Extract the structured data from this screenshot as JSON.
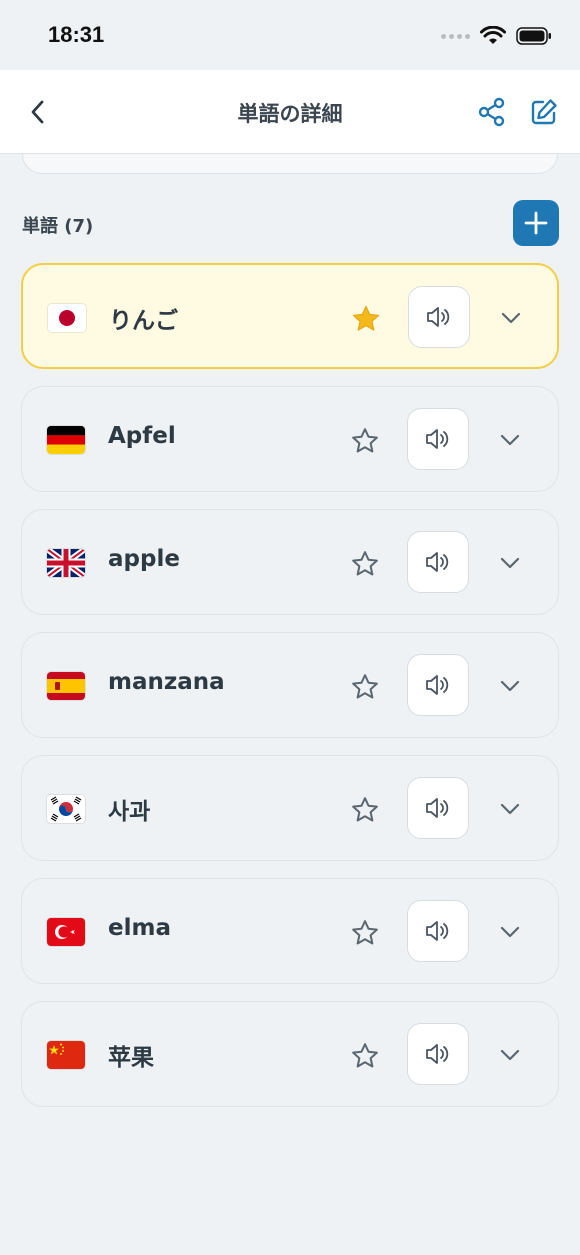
{
  "status_bar": {
    "time": "18:31"
  },
  "nav": {
    "title": "単語の詳細"
  },
  "section": {
    "label": "単語 (7)"
  },
  "colors": {
    "accent": "#1f78b4",
    "active_card_bg": "#fefbe2",
    "active_card_border": "#f2cf45",
    "star_gold": "#f5b81b"
  },
  "words": [
    {
      "flag": "jp-flag-icon",
      "text": "りんご",
      "favorite": true
    },
    {
      "flag": "de-flag-icon",
      "text": "Apfel",
      "favorite": false
    },
    {
      "flag": "gb-flag-icon",
      "text": "apple",
      "favorite": false
    },
    {
      "flag": "es-flag-icon",
      "text": "manzana",
      "favorite": false
    },
    {
      "flag": "kr-flag-icon",
      "text": "사과",
      "favorite": false
    },
    {
      "flag": "tr-flag-icon",
      "text": "elma",
      "favorite": false
    },
    {
      "flag": "cn-flag-icon",
      "text": "苹果",
      "favorite": false
    }
  ]
}
